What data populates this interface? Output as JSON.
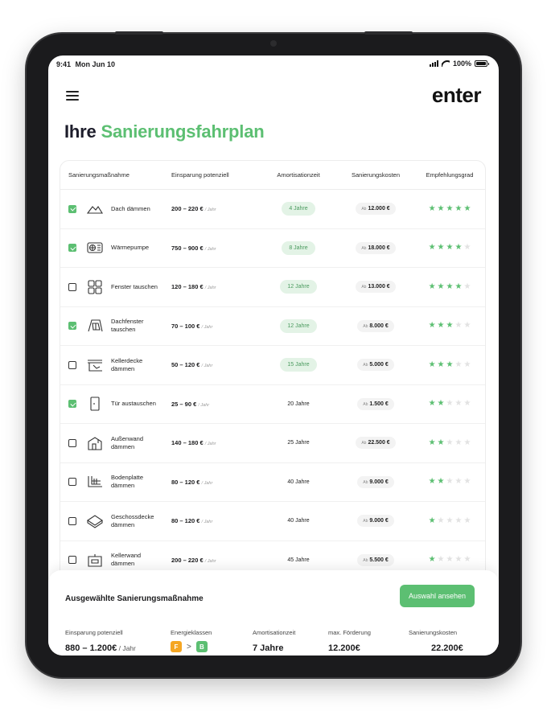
{
  "status": {
    "time": "9:41",
    "date": "Mon Jun 10",
    "battery": "100%"
  },
  "header": {
    "logo": "enter",
    "title_part1": "Ihre ",
    "title_part2": "Sanierungsfahrplan"
  },
  "table": {
    "columns": [
      "Sanierungsmaßnahme",
      "Einsparung potenziell",
      "Amortisationzeit",
      "Sanierungskosten",
      "Empfehlungsgrad"
    ],
    "rows": [
      {
        "checked": true,
        "icon": "roof-icon",
        "name": "Dach dämmen",
        "savings": "200 – 220 €",
        "unit": "/ Jahr",
        "years": "4 Jahre",
        "highlight": true,
        "cost_prefix": "Ab",
        "cost": "12.000 €",
        "stars": 5
      },
      {
        "checked": true,
        "icon": "heat-pump-icon",
        "name": "Wärmepumpe",
        "savings": "750 – 900 €",
        "unit": "/ Jahr",
        "years": "8 Jahre",
        "highlight": true,
        "cost_prefix": "Ab",
        "cost": "18.000 €",
        "stars": 4
      },
      {
        "checked": false,
        "icon": "window-icon",
        "name": "Fenster tauschen",
        "savings": "120 – 180 €",
        "unit": "/ Jahr",
        "years": "12 Jahre",
        "highlight": true,
        "cost_prefix": "Ab",
        "cost": "13.000 €",
        "stars": 4
      },
      {
        "checked": true,
        "icon": "skylight-icon",
        "name": "Dachfenster tauschen",
        "savings": "70 – 100 €",
        "unit": "/ Jahr",
        "years": "12 Jahre",
        "highlight": true,
        "cost_prefix": "Ab",
        "cost": "8.000 €",
        "stars": 3
      },
      {
        "checked": false,
        "icon": "basement-ceiling-icon",
        "name": "Kellerdecke dämmen",
        "savings": "50 – 120 €",
        "unit": "/ Jahr",
        "years": "15 Jahre",
        "highlight": true,
        "cost_prefix": "Ab",
        "cost": "5.000 €",
        "stars": 3
      },
      {
        "checked": true,
        "icon": "door-icon",
        "name": "Tür austauschen",
        "savings": "25 – 90 €",
        "unit": "/ Jahr",
        "years": "20 Jahre",
        "highlight": false,
        "cost_prefix": "Ab",
        "cost": "1.500 €",
        "stars": 2
      },
      {
        "checked": false,
        "icon": "exterior-wall-icon",
        "name": "Außenwand dämmen",
        "savings": "140 – 180 €",
        "unit": "/ Jahr",
        "years": "25 Jahre",
        "highlight": false,
        "cost_prefix": "Ab",
        "cost": "22.500 €",
        "stars": 2
      },
      {
        "checked": false,
        "icon": "floor-slab-icon",
        "name": "Bodenplatte dämmen",
        "savings": "80 – 120 €",
        "unit": "/ Jahr",
        "years": "40 Jahre",
        "highlight": false,
        "cost_prefix": "Ab",
        "cost": "9.000 €",
        "stars": 2
      },
      {
        "checked": false,
        "icon": "storey-ceiling-icon",
        "name": "Geschossdecke dämmen",
        "savings": "80 – 120 €",
        "unit": "/ Jahr",
        "years": "40 Jahre",
        "highlight": false,
        "cost_prefix": "Ab",
        "cost": "9.000 €",
        "stars": 1
      },
      {
        "checked": false,
        "icon": "basement-wall-icon",
        "name": "Kellerwand dämmen",
        "savings": "200 – 220 €",
        "unit": "/ Jahr",
        "years": "45 Jahre",
        "highlight": false,
        "cost_prefix": "Ab",
        "cost": "5.500 €",
        "stars": 1
      }
    ]
  },
  "summary": {
    "title": "Ausgewählte Sanierungsmaßnahme",
    "button": "Auswahl ansehen",
    "labels": {
      "savings": "Einsparung potenziell",
      "energy": "Energieklassen",
      "amort": "Amortisationzeit",
      "funding": "max. Förderung",
      "cost": "Sanierungskosten"
    },
    "values": {
      "savings": "880 – 1.200€",
      "savings_unit": " / Jahr",
      "energy_from": "F",
      "energy_to": "B",
      "energy_sep": ">",
      "amort": "7 Jahre",
      "funding": "12.200€",
      "cost": "22.200€"
    },
    "colors": {
      "energy_from": "#f5a623",
      "energy_to": "#5cbf72",
      "accent": "#5cbf72"
    }
  }
}
